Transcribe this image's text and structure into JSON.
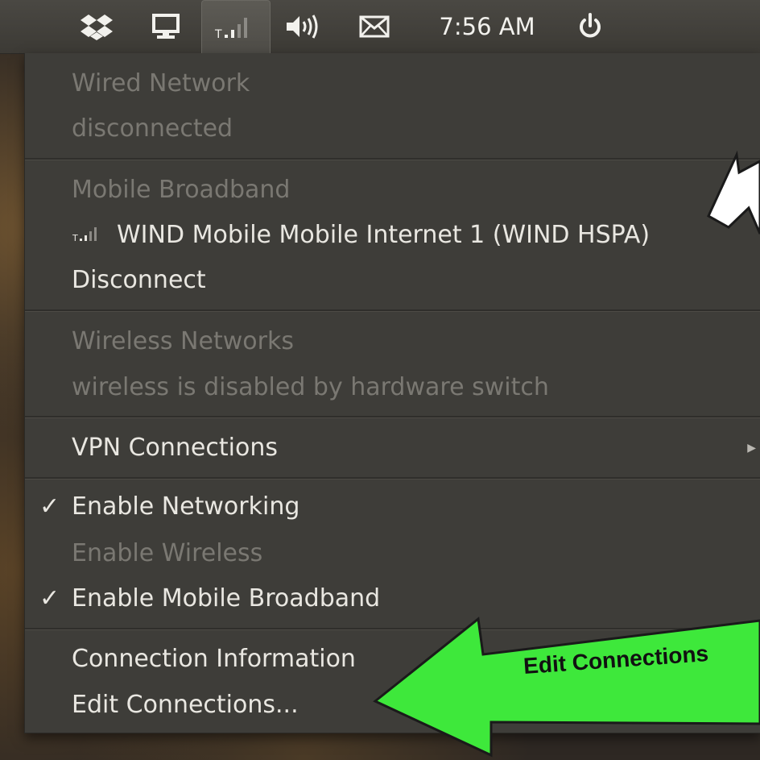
{
  "panel": {
    "clock": "7:56 AM",
    "icons": [
      "dropbox-icon",
      "monitor-icon",
      "mobile-signal-icon",
      "volume-icon",
      "mail-icon",
      "power-icon"
    ]
  },
  "menu": {
    "wired_header": "Wired Network",
    "wired_status": "disconnected",
    "mobile_header": "Mobile Broadband",
    "mobile_connection": "WIND Mobile Mobile Internet 1 (WIND HSPA)",
    "disconnect": "Disconnect",
    "wireless_header": "Wireless Networks",
    "wireless_status": "wireless is disabled by hardware switch",
    "vpn": "VPN Connections",
    "enable_networking": "Enable Networking",
    "enable_wireless": "Enable Wireless",
    "enable_mobile": "Enable Mobile Broadband",
    "connection_info": "Connection Information",
    "edit_connections": "Edit Connections..."
  },
  "annotation": {
    "green_arrow_text": "Edit Connections",
    "green_color": "#3ee83b",
    "white_arrow_color": "#ffffff"
  }
}
